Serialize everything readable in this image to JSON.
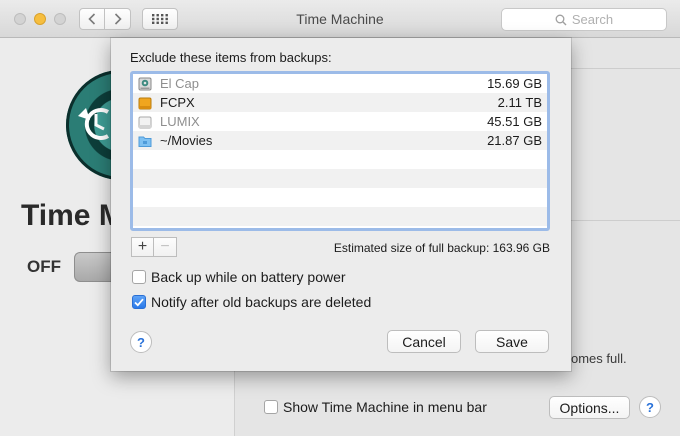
{
  "window": {
    "title": "Time Machine",
    "search_placeholder": "Search"
  },
  "background": {
    "pane_name": "Time Machine",
    "toggle_label": "OFF",
    "partial_text": "omes full.",
    "show_in_menu_bar": {
      "label": "Show Time Machine in menu bar",
      "checked": false
    },
    "options_label": "Options...",
    "help_label": "?"
  },
  "sheet": {
    "heading": "Exclude these items from backups:",
    "items": [
      {
        "name": "El Cap",
        "size": "15.69 GB",
        "icon": "internal-disk-icon",
        "dimmed": true
      },
      {
        "name": "FCPX",
        "size": "2.11 TB",
        "icon": "external-disk-icon",
        "dimmed": false
      },
      {
        "name": "LUMIX",
        "size": "45.51 GB",
        "icon": "removable-disk-icon",
        "dimmed": true
      },
      {
        "name": "~/Movies",
        "size": "21.87 GB",
        "icon": "folder-icon",
        "dimmed": false
      }
    ],
    "add_label": "+",
    "remove_label": "−",
    "estimate": "Estimated size of full backup: 163.96 GB",
    "battery": {
      "label": "Back up while on battery power",
      "checked": false
    },
    "notify": {
      "label": "Notify after old backups are deleted",
      "checked": true
    },
    "help_label": "?",
    "cancel_label": "Cancel",
    "save_label": "Save"
  },
  "colors": {
    "accent": "#2a79e9",
    "yellow_button": "#f6be3f",
    "list_focus_ring": "#9cbbe8"
  }
}
